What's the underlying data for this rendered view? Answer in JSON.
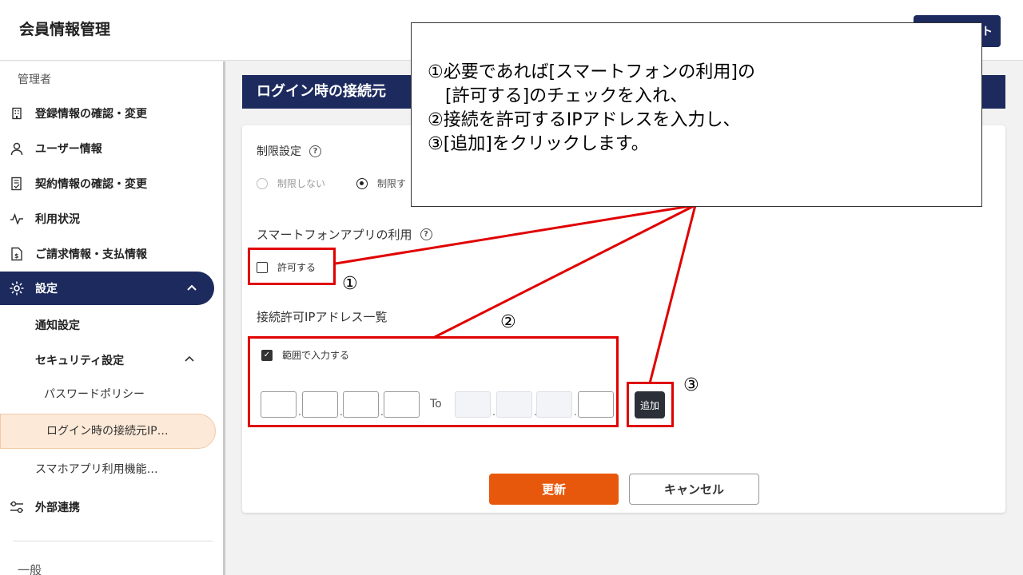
{
  "header": {
    "title": "会員情報管理",
    "logout_label": "ト"
  },
  "sidebar": {
    "section_admin": "管理者",
    "items": [
      {
        "label": "登録情報の確認・変更",
        "icon": "building-icon"
      },
      {
        "label": "ユーザー情報",
        "icon": "user-icon"
      },
      {
        "label": "契約情報の確認・変更",
        "icon": "contract-icon"
      },
      {
        "label": "利用状況",
        "icon": "activity-icon"
      },
      {
        "label": "ご請求情報・支払情報",
        "icon": "invoice-icon"
      },
      {
        "label": "設定",
        "icon": "gear-icon"
      }
    ],
    "sub_notification": "通知設定",
    "sub_security": "セキュリティ設定",
    "sub_password": "パスワードポリシー",
    "sub_login_ip": "ログイン時の接続元IP…",
    "sub_smartphone": "スマホアプリ利用機能…",
    "external": "外部連携",
    "section_general": "一般"
  },
  "page": {
    "heading": "ログイン時の接続元",
    "restriction_label": "制限設定",
    "radio_no_limit": "制限しない",
    "radio_limit": "制限す",
    "app_usage_label": "スマートフォンアプリの利用",
    "allow_label": "許可する",
    "ip_list_label": "接続許可IPアドレス一覧",
    "range_label": "範囲で入力する",
    "to_label": "To",
    "add_label": "追加",
    "update_label": "更新",
    "cancel_label": "キャンセル"
  },
  "annotations": {
    "callout_lines": [
      "①必要であれば[スマートフォンの利用]の",
      "　[許可する]のチェックを入れ、",
      "②接続を許可するIPアドレスを入力し、",
      "③[追加]をクリックします。"
    ],
    "mark1": "①",
    "mark2": "②",
    "mark3": "③"
  },
  "colors": {
    "navy": "#1d2a5e",
    "orange": "#e8580c",
    "highlight_red": "#e00000"
  }
}
